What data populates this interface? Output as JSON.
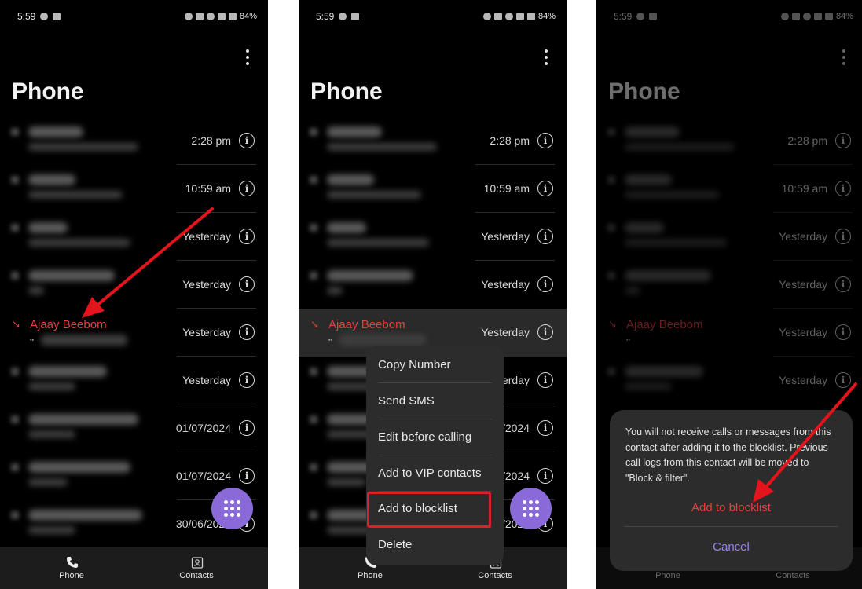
{
  "status_bar": {
    "time": "5:59",
    "battery": "84%"
  },
  "screen_title": "Phone",
  "call_log": [
    {
      "time": "2:28 pm"
    },
    {
      "time": "10:59 am"
    },
    {
      "time": "Yesterday"
    },
    {
      "time": "Yesterday"
    },
    {
      "name": "Ajaay Beebom",
      "time": "Yesterday"
    },
    {
      "time": "Yesterday"
    },
    {
      "time": "01/07/2024"
    },
    {
      "time": "01/07/2024"
    },
    {
      "time": "30/06/2024"
    }
  ],
  "context_menu": {
    "items": [
      "Copy Number",
      "Send SMS",
      "Edit before calling",
      "Add to VIP contacts",
      "Add to blocklist",
      "Delete"
    ],
    "highlighted": "Add to blocklist"
  },
  "dialog": {
    "message": "You will not receive calls or messages from this contact after adding it to the blocklist. Previous call logs from this contact will be moved to \"Block & filter\".",
    "confirm": "Add to blocklist",
    "cancel": "Cancel"
  },
  "bottom_nav": {
    "phone": "Phone",
    "contacts": "Contacts"
  },
  "colors": {
    "accent_red": "#e5403f",
    "fab_purple": "#8a6ad8",
    "cancel_purple": "#9b85e6",
    "annotation_red": "#e3141b"
  },
  "icons": [
    "whatsapp-icon",
    "alarm-icon",
    "bluetooth-icon",
    "wifi-icon",
    "signal-icon",
    "battery-icon",
    "more-options-icon",
    "info-icon",
    "missed-call-icon",
    "dialpad-icon",
    "phone-icon",
    "contacts-icon"
  ]
}
